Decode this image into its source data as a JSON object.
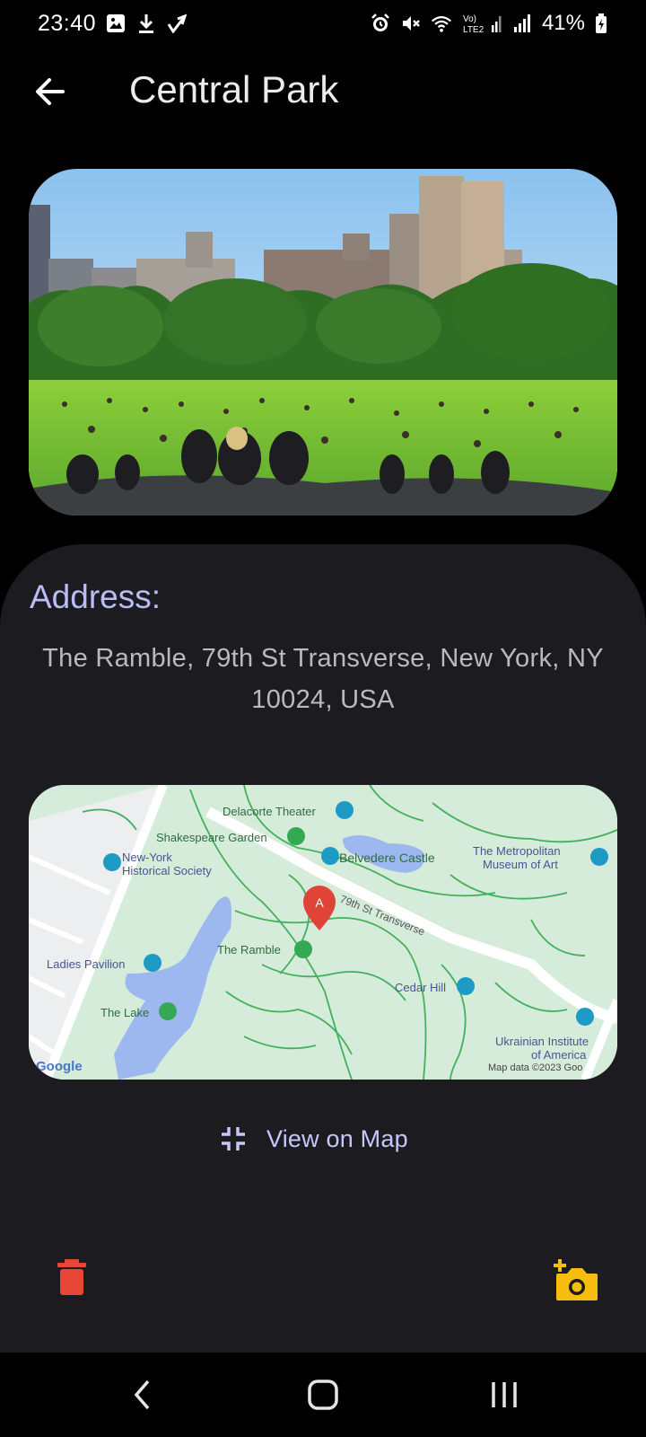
{
  "status_bar": {
    "time": "23:40",
    "battery": "41%",
    "icons_left": [
      "image-icon",
      "download-icon",
      "check-icon"
    ],
    "icons_right": [
      "alarm-icon",
      "mute-icon",
      "wifi-icon",
      "volte-icon",
      "signal-icon",
      "battery-icon"
    ]
  },
  "app_bar": {
    "title": "Central Park",
    "back_icon": "arrow-back-icon"
  },
  "photo": {
    "icon": "park-photo"
  },
  "details": {
    "address_label": "Address:",
    "address_value": "The Ramble, 79th St Transverse, New York, NY 10024, USA"
  },
  "map": {
    "labels": {
      "delacorte": "Delacorte Theater",
      "shakespeare": "Shakespeare Garden",
      "nyhs_1": "New-York",
      "nyhs_2": "Historical Society",
      "belvedere": "Belvedere Castle",
      "met_1": "The Metropolitan",
      "met_2": "Museum of Art",
      "transverse": "79th St Transverse",
      "ramble": "The Ramble",
      "ladies": "Ladies Pavilion",
      "cedar": "Cedar Hill",
      "lake": "The Lake",
      "ukr_1": "Ukrainian Institute",
      "ukr_2": "of America",
      "marker": "A",
      "google": "Google",
      "credit": "Map data ©2023 Goo"
    }
  },
  "actions": {
    "view_on_map": "View on Map",
    "colors": {
      "delete": "#e74635",
      "add_photo": "#f4bd10",
      "accent": "#c5c7fb"
    }
  },
  "nav_bar": {
    "back_icon": "nav-back-icon",
    "home_icon": "nav-home-icon",
    "recents_icon": "nav-recents-icon"
  }
}
